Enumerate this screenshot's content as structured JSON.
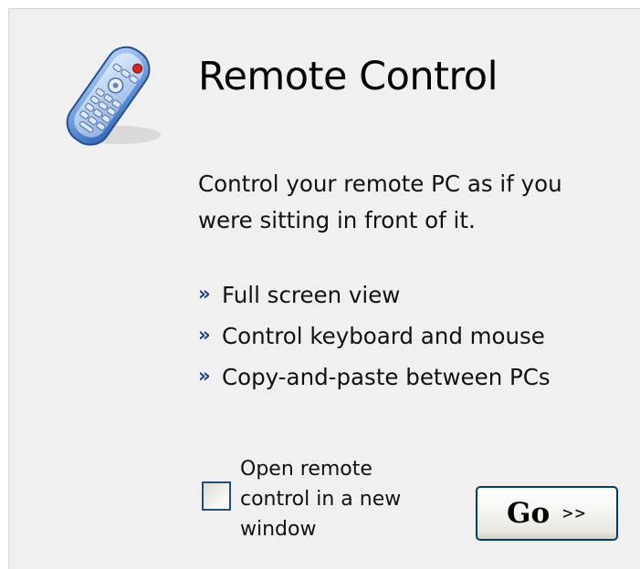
{
  "panel": {
    "title": "Remote Control",
    "description": "Control your remote PC as if you were sitting in front of it.",
    "features": [
      "Full screen view",
      "Control keyboard and mouse",
      "Copy-and-paste between PCs"
    ],
    "bullet_glyph": "»",
    "bullet_icon": "double-chevron-right-icon",
    "header_icon": "remote-control-icon",
    "accent_color": "#1f3f94"
  },
  "option": {
    "label": "Open remote\ncontrol in a new\nwindow",
    "checked": false
  },
  "go_button": {
    "label": "Go",
    "arrows": ">>"
  }
}
